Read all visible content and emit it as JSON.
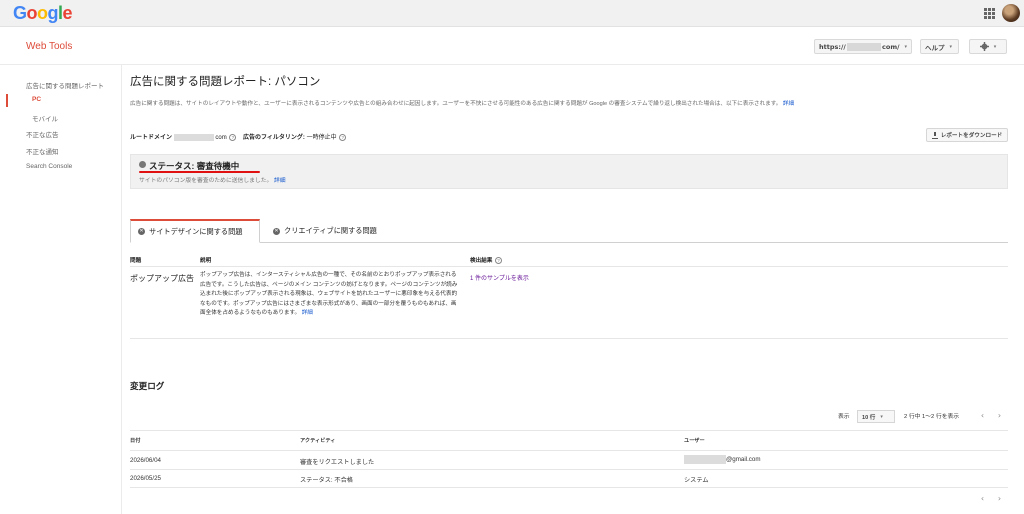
{
  "topbar": {
    "logo": {
      "G": "G",
      "o1": "o",
      "o2": "o",
      "g": "g",
      "l": "l",
      "e": "e"
    },
    "apps_icon": "apps-grid-icon",
    "avatar_icon": "user-avatar"
  },
  "header": {
    "app_title": "Web Tools",
    "property_prefix": "https://",
    "property_suffix": "com/",
    "help_label": "ヘルプ",
    "settings_icon": "gear-icon",
    "caret": "▾"
  },
  "sidebar": {
    "items": [
      "広告に関する問題レポート",
      "PC",
      "モバイル",
      "不正な広告",
      "不正な通知",
      "Search Console"
    ]
  },
  "main": {
    "title": "広告に関する問題レポート: パソコン",
    "intro": "広告に関する問題は、サイトのレイアウトや動作と、ユーザーに表示されるコンテンツや広告との組み合わせに起因します。ユーザーを不快にさせる可能性のある広告に関する問題が Google の審査システムで繰り返し検出された場合は、以下に表示されます。",
    "intro_link": "詳細",
    "root_domain_label": "ルートドメイン",
    "root_domain_suffix": "com",
    "filtering_label": "広告のフィルタリング:",
    "filtering_value": "一時停止中",
    "help_mark": "?",
    "download_label": "レポートをダウンロード"
  },
  "status": {
    "title": "ステータス: 審査待機中",
    "desc": "サイトのパソコン版を審査のために送信しました。",
    "link": "詳細"
  },
  "tabs": [
    {
      "label": "サイトデザインに関する問題"
    },
    {
      "label": "クリエイティブに関する問題"
    }
  ],
  "x_mark": "✕",
  "issues": {
    "columns": [
      "問題",
      "説明",
      "検出結果"
    ],
    "rows": [
      {
        "name": "ポップアップ広告",
        "desc": "ポップアップ広告は、インタースティシャル広告の一種で、その名前のとおりポップアップ表示される広告です。こうした広告は、ページのメイン コンテンツの妨げとなります。ページのコンテンツが読み込まれた後にポップアップ表示される現象は、ウェブサイトを訪れたユーザーに悪印象を与える代表的なものです。ポップアップ広告にはさまざまな表示形式があり、画面の一部分を覆うものもあれば、画面全体を占めるようなものもあります。",
        "desc_link": "詳細",
        "result": "1 件のサンプルを表示"
      }
    ]
  },
  "changelog": {
    "title": "変更ログ",
    "display_label": "表示",
    "rows_value": "10 行",
    "range_text": "2 行中 1〜2 行を表示",
    "prev": "‹",
    "next": "›",
    "columns": [
      "日付",
      "アクティビティ",
      "ユーザー"
    ],
    "rows": [
      {
        "date": "2026/06/04",
        "activity": "審査をリクエストしました",
        "user_suffix": "@gmail.com"
      },
      {
        "date": "2026/05/25",
        "activity": "ステータス: 不合格",
        "user": "システム"
      }
    ]
  },
  "colors": {
    "accent_red": "#dd4b39",
    "link_blue": "#1155cc",
    "result_purple": "#6a1b9a",
    "annotation_red": "#e01010"
  }
}
